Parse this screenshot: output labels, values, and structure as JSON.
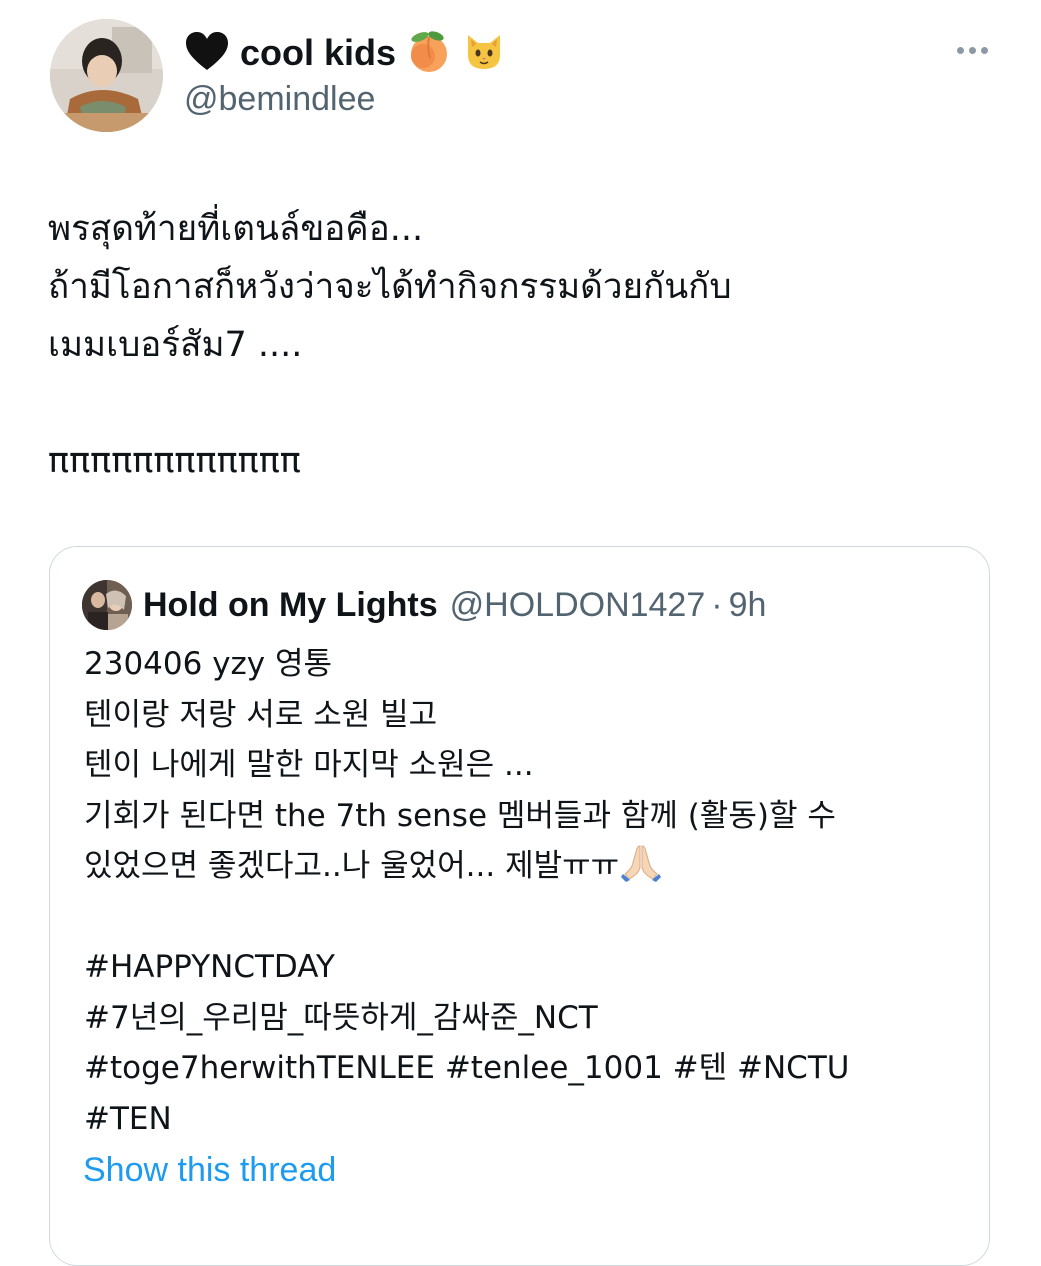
{
  "tweet": {
    "author": {
      "display_name": "cool kids",
      "handle": "@bemindlee",
      "name_emoji_icons": [
        "black-heart-icon",
        "peach-icon",
        "cat-face-icon"
      ]
    },
    "text_lines": [
      "พรสุดท้ายที่เตนล์ขอคือ...",
      "ถ้ามีโอกาสก็หวังว่าจะได้ทำกิจกรรมด้วยกันกับ",
      "เมมเบอร์สัม7 ....",
      "",
      "ππππππππππππ"
    ]
  },
  "quote": {
    "author": {
      "display_name": "Hold on My Lights",
      "handle": "@HOLDON1427",
      "separator": "·",
      "time": "9h"
    },
    "lines": [
      "230406 yzy 영통",
      "텐이랑 저랑 서로 소원 빌고",
      "텐이 나에게 말한 마지막 소원은 ...",
      "기회가 된다면 the 7th sense 멤버들과 함께 (활동)할 수",
      "있었으면 좋겠다고..나 울었어... 제발ㅠㅠ",
      "",
      "#HAPPYNCTDAY",
      "#7년의_우리맘_따뜻하게_감싸준_NCT",
      "#toge7herwithTENLEE #tenlee_1001 #텐 #NCTU",
      "#TEN"
    ],
    "show_thread_label": "Show this thread"
  },
  "colors": {
    "text_primary": "#0f1419",
    "text_secondary": "#536471",
    "link": "#1d9bf0",
    "border": "#cfd9de"
  }
}
